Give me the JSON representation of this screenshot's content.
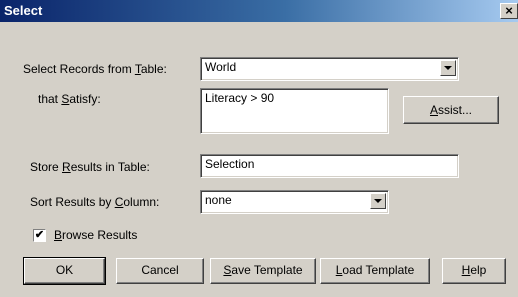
{
  "dialog": {
    "title": "Select",
    "close_glyph": "×"
  },
  "form": {
    "table_label_pre": "Select Records from ",
    "table_label_key": "T",
    "table_label_post": "able:",
    "table_value": "World",
    "satisfy_label_pre": "that ",
    "satisfy_label_key": "S",
    "satisfy_label_post": "atisfy:",
    "condition_value": "Literacy > 90",
    "store_label_pre": "Store ",
    "store_label_key": "R",
    "store_label_post": "esults in Table:",
    "store_value": "Selection",
    "sort_label_pre": "Sort Results by ",
    "sort_label_key": "C",
    "sort_label_post": "olumn:",
    "sort_value": "none",
    "browse_key": "B",
    "browse_rest": "rowse Results",
    "browse_checked": true,
    "check_glyph": "✔"
  },
  "buttons": {
    "assist_key": "A",
    "assist_rest": "ssist...",
    "ok": "OK",
    "cancel": "Cancel",
    "save_key": "S",
    "save_rest": "ave Template",
    "load_key": "L",
    "load_rest": "oad Template",
    "help_key": "H",
    "help_rest": "elp"
  }
}
